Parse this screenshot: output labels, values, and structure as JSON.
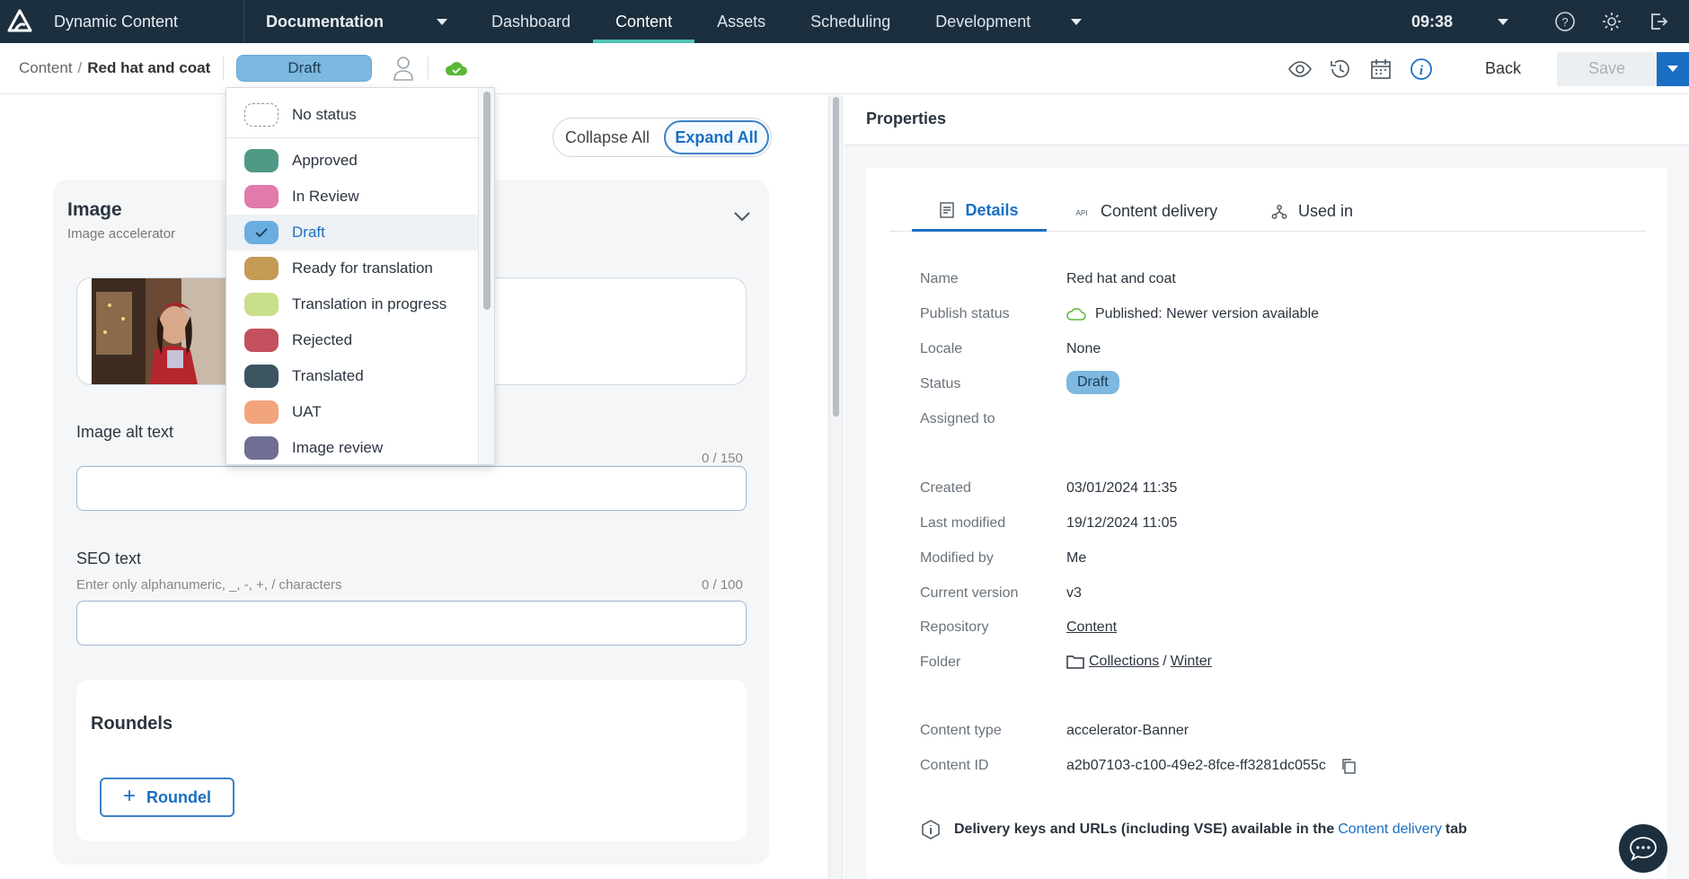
{
  "topbar": {
    "app_name": "Dynamic Content",
    "hub": "Documentation",
    "nav": [
      "Dashboard",
      "Content",
      "Assets",
      "Scheduling",
      "Development"
    ],
    "time": "09:38"
  },
  "subbar": {
    "breadcrumb_root": "Content",
    "breadcrumb_sep": "/",
    "breadcrumb_current": "Red hat and coat",
    "status": "Draft",
    "back": "Back",
    "save": "Save"
  },
  "editor": {
    "collapse_all": "Collapse All",
    "expand_all": "Expand All",
    "card_title": "Image",
    "card_subtitle": "Image accelerator",
    "alt_label": "Image alt text",
    "alt_count": "0 / 150",
    "seo_label": "SEO text",
    "seo_hint": "Enter only alphanumeric, _, -, +, / characters",
    "seo_count": "0 / 100",
    "roundels_title": "Roundels",
    "roundel_button": "Roundel"
  },
  "status_dropdown": {
    "items": [
      {
        "label": "No status",
        "color": ""
      },
      {
        "label": "Approved",
        "color": "#4f9a86"
      },
      {
        "label": "In Review",
        "color": "#e37aad"
      },
      {
        "label": "Draft",
        "color": "#6aaee0"
      },
      {
        "label": "Ready for translation",
        "color": "#c49a55"
      },
      {
        "label": "Translation in progress",
        "color": "#c9df8c"
      },
      {
        "label": "Rejected",
        "color": "#c2505e"
      },
      {
        "label": "Translated",
        "color": "#3b5560"
      },
      {
        "label": "UAT",
        "color": "#f2a57c"
      },
      {
        "label": "Image review",
        "color": "#6f6e93"
      }
    ],
    "selected": "Draft"
  },
  "properties": {
    "title": "Properties",
    "tabs": [
      "Details",
      "Content delivery",
      "Used in"
    ],
    "rows": {
      "name_label": "Name",
      "name_value": "Red hat and coat",
      "publish_label": "Publish status",
      "publish_value": "Published: Newer version available",
      "locale_label": "Locale",
      "locale_value": "None",
      "status_label": "Status",
      "status_value": "Draft",
      "assigned_label": "Assigned to",
      "created_label": "Created",
      "created_value": "03/01/2024 11:35",
      "modified_label": "Last modified",
      "modified_value": "19/12/2024 11:05",
      "modified_by_label": "Modified by",
      "modified_by_value": "Me",
      "version_label": "Current version",
      "version_value": "v3",
      "repo_label": "Repository",
      "repo_value": "Content",
      "folder_label": "Folder",
      "folder_1": "Collections",
      "folder_sep": "/",
      "folder_2": "Winter",
      "type_label": "Content type",
      "type_value": "accelerator-Banner",
      "id_label": "Content ID",
      "id_value": "a2b07103-c100-49e2-8fce-ff3281dc055c"
    },
    "info_text": "Delivery keys and URLs (including VSE) available in the",
    "info_link": "Content delivery",
    "info_tail": "tab"
  }
}
